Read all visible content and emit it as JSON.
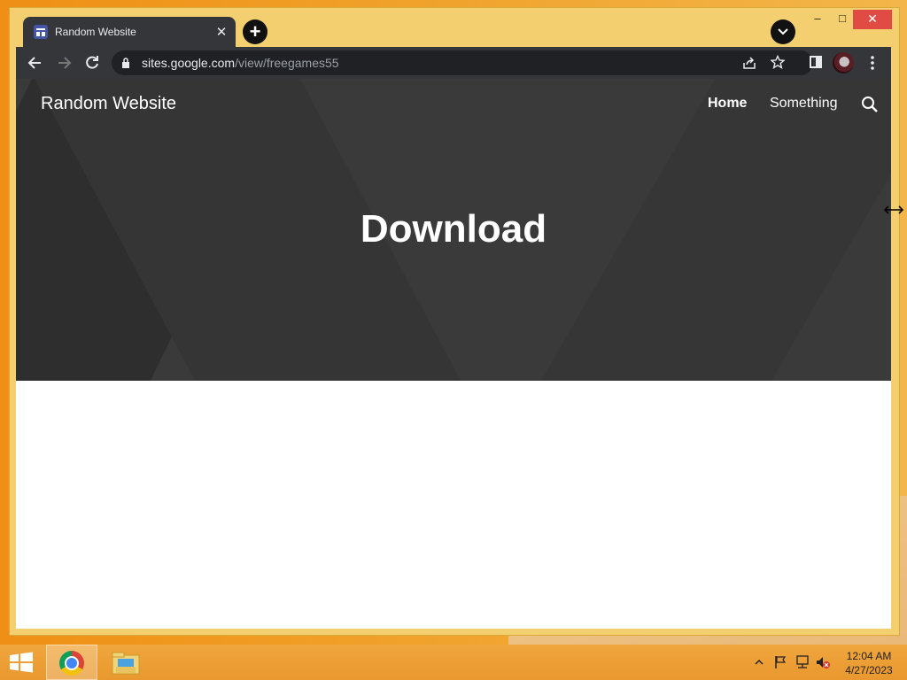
{
  "browser": {
    "tab_title": "Random Website",
    "tab_close": "✕",
    "new_tab": "+",
    "url_host": "sites.google.com",
    "url_path": "/view/freegames55",
    "window_min": "–",
    "window_max": "□",
    "window_close": "✕"
  },
  "site": {
    "name": "Random Website",
    "nav": {
      "home": "Home",
      "something": "Something"
    },
    "hero_title": "Download"
  },
  "taskbar": {
    "time": "12:04 AM",
    "date": "4/27/2023"
  },
  "colors": {
    "hero_bg": "#3a3a3a",
    "browser_chrome": "#35363a",
    "window_frame": "#f4cf6f",
    "close_button": "#e04b43"
  }
}
